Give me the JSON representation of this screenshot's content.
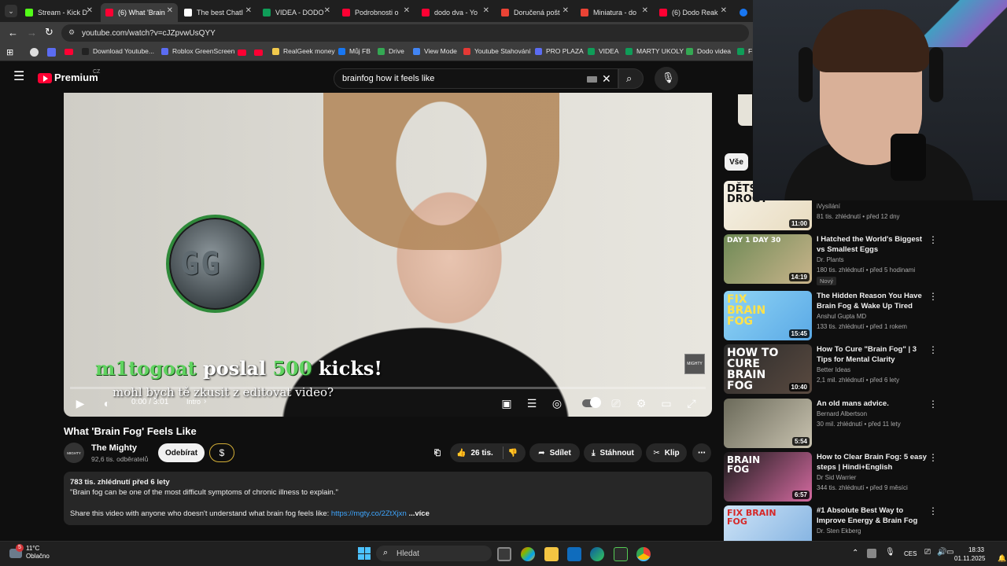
{
  "browser": {
    "tabs": [
      {
        "title": "Stream - Kick D",
        "color": "#53fc18"
      },
      {
        "title": "(6) What 'Brain",
        "color": "#ff0033"
      },
      {
        "title": "The best ChatI",
        "color": "#ffffff"
      },
      {
        "title": "VIDEA - DODO",
        "color": "#0f9d58"
      },
      {
        "title": "Podrobnosti o",
        "color": "#ff0033"
      },
      {
        "title": "dodo dva - Yo",
        "color": "#ff0033"
      },
      {
        "title": "Doručená pošt",
        "color": "#ea4335"
      },
      {
        "title": "Miniatura - do",
        "color": "#ea4335"
      },
      {
        "title": "(6) Dodo Reak",
        "color": "#ff0033"
      }
    ],
    "url": "youtube.com/watch?v=cJZpvwUsQYY",
    "bookmarks": [
      "Download Youtube...",
      "Roblox GreenScreen",
      "RealGeek money",
      "Můj FB",
      "Drive",
      "View Mode",
      "Youtube Stahování",
      "PRO PLAZA",
      "VIDEA",
      "MARTY UKOLY",
      "Dodo videa",
      "F"
    ]
  },
  "youtube": {
    "logo": "Premium",
    "logo_region": "CZ",
    "search_query": "brainfog how it feels like",
    "player": {
      "time": "0:00 / 3:01",
      "chapter": "Intro",
      "progress": 0.0,
      "brand_watermark": "MIGHTY",
      "donation_user": "m1togoat",
      "donation_verb": "poslal",
      "donation_amount": "500",
      "donation_unit": "kicks!",
      "donation_message": "mohl bych tě zkusit z editovat video?",
      "coin_text": "GG"
    },
    "video": {
      "title": "What 'Brain Fog' Feels Like",
      "channel": "The Mighty",
      "channel_avatar": "MIGHTY",
      "subscribers": "92,6 tis. odběratelů",
      "subscribe_label": "Odebírat",
      "thanks_label": "$",
      "likes": "26 tis.",
      "share_label": "Sdílet",
      "download_label": "Stáhnout",
      "clip_label": "Klip",
      "views_date": "783 tis. zhlédnutí  před 6 lety",
      "desc_line1": "\"Brain fog can be one of the most difficult symptoms of chronic illness to explain.\"",
      "desc_line2": "Share this video with anyone who doesn't understand what brain fog feels like: ",
      "desc_link": "https://mgty.co/2ZtXjxn",
      "desc_more": " ...více"
    },
    "sidebar": {
      "chip_all": "Vše",
      "recommendations": [
        {
          "thumb_text": "DĚTSKÉ DROGY",
          "duration": "11:00",
          "title": "",
          "channel": "iVysílání",
          "meta": "81 tis. zhlédnutí • před 12 dny",
          "badge": ""
        },
        {
          "thumb_text": "DAY 1   DAY 30",
          "duration": "14:19",
          "title": "I Hatched the World's Biggest vs Smallest Eggs",
          "channel": "Dr. Plants",
          "meta": "180 tis. zhlédnutí • před 5 hodinami",
          "badge": "Nový"
        },
        {
          "thumb_text": "FIX BRAIN FOG",
          "duration": "15:45",
          "title": "The Hidden Reason You Have Brain Fog & Wake Up Tired",
          "channel": "Anshul Gupta MD",
          "meta": "133 tis. zhlédnutí • před 1 rokem",
          "badge": ""
        },
        {
          "thumb_text": "HOW TO CURE BRAIN FOG",
          "duration": "10:40",
          "title": "How To Cure \"Brain Fog\" | 3 Tips for Mental Clarity",
          "channel": "Better Ideas",
          "meta": "2,1 mil. zhlédnutí • před 6 lety",
          "badge": ""
        },
        {
          "thumb_text": "",
          "duration": "5:54",
          "title": "An old mans advice.",
          "channel": "Bernard Albertson",
          "meta": "30 mil. zhlédnutí • před 11 lety",
          "badge": ""
        },
        {
          "thumb_text": "BRAIN FOG",
          "duration": "6:57",
          "title": "How to Clear Brain Fog: 5 easy steps | Hindi+English",
          "channel": "Dr Sid Warrier",
          "meta": "344 tis. zhlédnutí • před 9 měsíci",
          "badge": ""
        },
        {
          "thumb_text": "FIX BRAIN FOG",
          "duration": "",
          "title": "#1 Absolute Best Way to Improve Energy & Brain Fog",
          "channel": "Dr. Sten Ekberg",
          "meta": "",
          "badge": ""
        }
      ]
    }
  },
  "taskbar": {
    "weather_temp": "11°C",
    "weather_desc": "Oblačno",
    "weather_badge": "5",
    "search_placeholder": "Hledat",
    "language": "CES",
    "time": "18:33",
    "date": "01.11.2025"
  },
  "colors": {
    "accent_red": "#ff0033",
    "link_blue": "#3ea6ff",
    "donation_green": "#5fd35f"
  }
}
